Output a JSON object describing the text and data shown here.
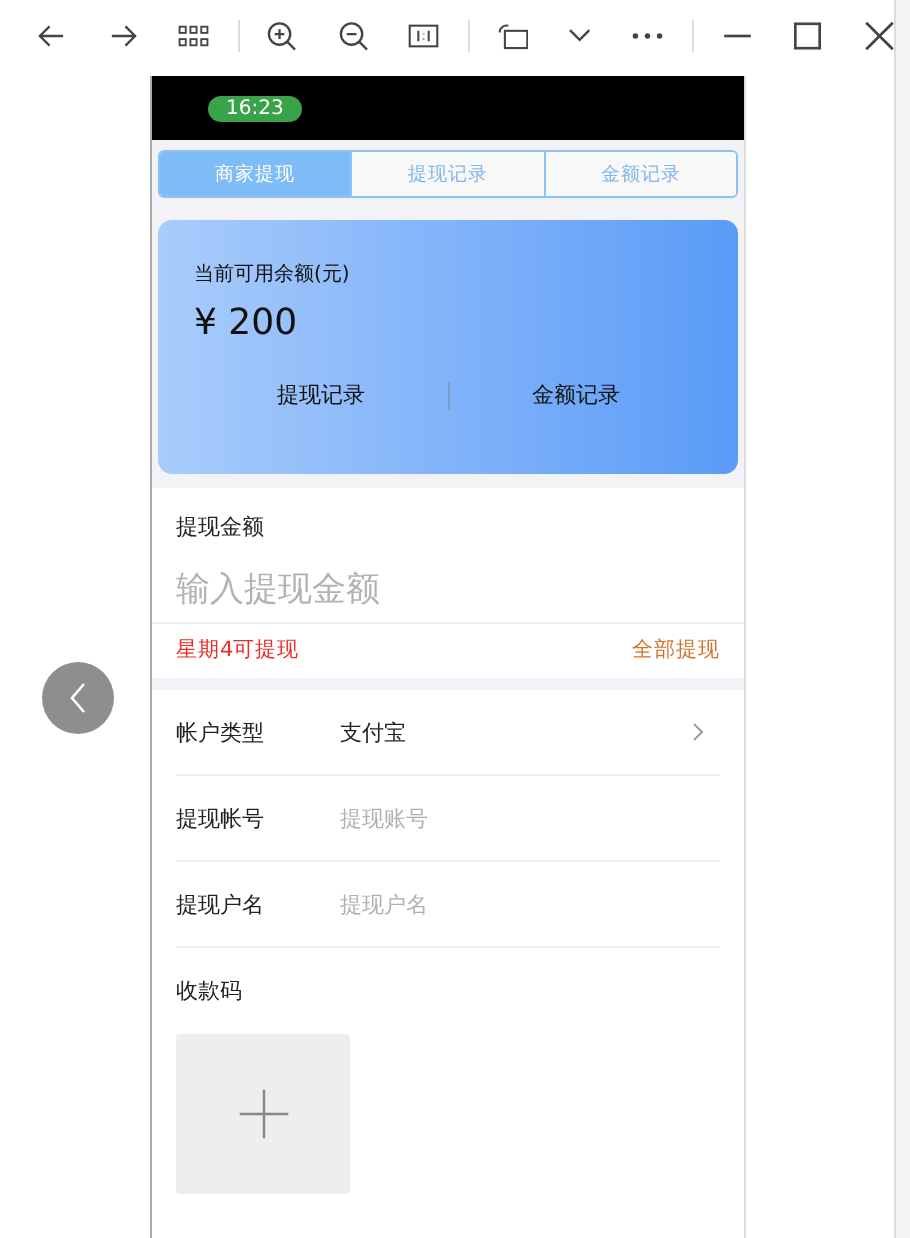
{
  "status_bar": {
    "time": "16:23"
  },
  "tabs": [
    {
      "label": "商家提现",
      "selected": true
    },
    {
      "label": "提现记录",
      "selected": false
    },
    {
      "label": "金额记录",
      "selected": false
    }
  ],
  "balance_card": {
    "label": "当前可用余额(元)",
    "amount": "¥ 200",
    "links": [
      "提现记录",
      "金额记录"
    ]
  },
  "withdraw": {
    "label": "提现金额",
    "placeholder": "输入提现金额",
    "note": "星期4可提现",
    "action": "全部提现"
  },
  "form_rows": [
    {
      "kind": "select",
      "label": "帐户类型",
      "value": "支付宝"
    },
    {
      "kind": "input",
      "label": "提现帐号",
      "placeholder": "提现账号"
    },
    {
      "kind": "input",
      "label": "提现户名",
      "placeholder": "提现户名"
    }
  ],
  "upload": {
    "label": "收款码"
  }
}
